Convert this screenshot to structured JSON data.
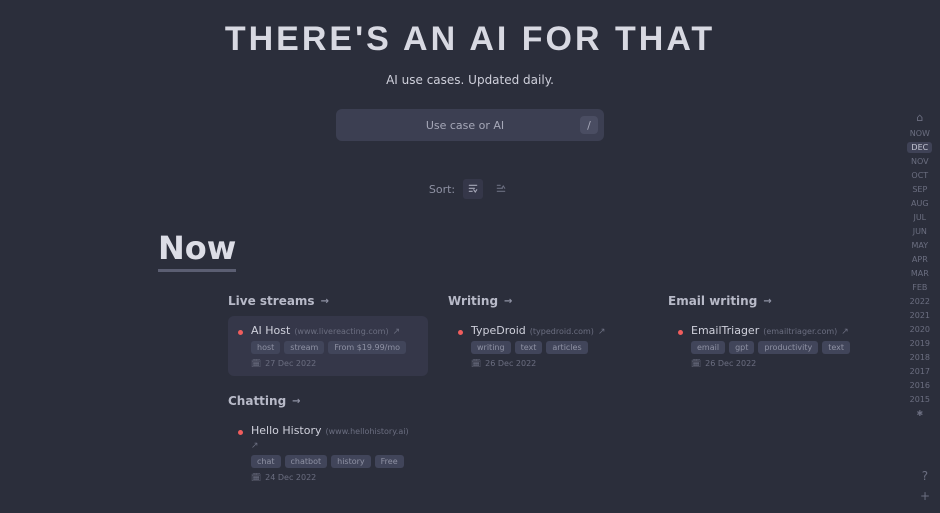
{
  "header": {
    "title": "THERE'S AN AI FOR THAT",
    "subtitle": "AI use cases. Updated daily."
  },
  "search": {
    "placeholder": "Use case or AI",
    "shortcut": "/"
  },
  "sort": {
    "label": "Sort:"
  },
  "now": {
    "title": "Now"
  },
  "categories": [
    {
      "name": "Live streams",
      "active": true,
      "items": [
        {
          "title": "AI Host",
          "url": "(www.livereacting.com)",
          "tags": [
            "host",
            "stream",
            "From $19.99/mo"
          ],
          "date": "27 Dec 2022"
        }
      ]
    },
    {
      "name": "Writing",
      "active": false,
      "items": [
        {
          "title": "TypeDroid",
          "url": "(typedroid.com)",
          "tags": [
            "writing",
            "text",
            "articles"
          ],
          "date": "26 Dec 2022"
        }
      ]
    },
    {
      "name": "Email writing",
      "active": false,
      "items": [
        {
          "title": "EmailTriager",
          "url": "(emailtriager.com)",
          "tags": [
            "email",
            "gpt",
            "productivity",
            "text"
          ],
          "date": "26 Dec 2022"
        }
      ]
    },
    {
      "name": "Chatting",
      "active": false,
      "items": [
        {
          "title": "Hello History",
          "url": "(www.hellohistory.ai)",
          "tags": [
            "chat",
            "chatbot",
            "history",
            "Free"
          ],
          "date": "24 Dec 2022"
        }
      ]
    }
  ],
  "sidenav": [
    {
      "label": "⌂",
      "type": "icon"
    },
    {
      "label": "NOW"
    },
    {
      "label": "DEC",
      "active": true
    },
    {
      "label": "NOV"
    },
    {
      "label": "OCT"
    },
    {
      "label": "SEP"
    },
    {
      "label": "AUG"
    },
    {
      "label": "JUL"
    },
    {
      "label": "JUN"
    },
    {
      "label": "MAY"
    },
    {
      "label": "APR"
    },
    {
      "label": "MAR"
    },
    {
      "label": "FEB"
    },
    {
      "label": "2022"
    },
    {
      "label": "2021"
    },
    {
      "label": "2020"
    },
    {
      "label": "2019"
    },
    {
      "label": "2018"
    },
    {
      "label": "2017"
    },
    {
      "label": "2016"
    },
    {
      "label": "2015"
    },
    {
      "label": "✱",
      "type": "icon"
    }
  ],
  "corner": {
    "help": "?",
    "add": "+"
  }
}
